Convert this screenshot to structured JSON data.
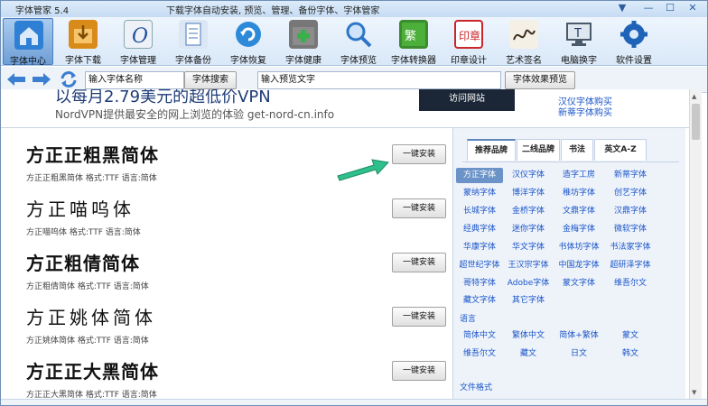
{
  "window": {
    "app_title": "字体管家 5.4",
    "doc_title": "下载字体自动安装, 预览、管理、备份字体、字体管家",
    "buttons": {
      "menu": "▼",
      "minimize": "—",
      "maximize": "☐",
      "close": "✕"
    }
  },
  "toolbar": {
    "items": [
      {
        "label": "字体中心",
        "icon": "home-icon",
        "color": "#2f7fd4"
      },
      {
        "label": "字体下载",
        "icon": "download-box-icon",
        "color": "#d98b1a"
      },
      {
        "label": "字体管理",
        "icon": "font-manage-icon",
        "color": "#1f4f9c"
      },
      {
        "label": "字体备份",
        "icon": "document-icon",
        "color": "#4a78b8"
      },
      {
        "label": "字体恢复",
        "icon": "restore-icon",
        "color": "#2c8ad8"
      },
      {
        "label": "字体健康",
        "icon": "medkit-icon",
        "color": "#3a9a3a"
      },
      {
        "label": "字体预览",
        "icon": "magnifier-icon",
        "color": "#2d76c7"
      },
      {
        "label": "字体转换器",
        "icon": "converter-icon",
        "color": "#3a8c2e"
      },
      {
        "label": "印章设计",
        "icon": "seal-icon",
        "color": "#c8262a"
      },
      {
        "label": "艺术签名",
        "icon": "signature-icon",
        "color": "#8a6a3a"
      },
      {
        "label": "电脑换字",
        "icon": "monitor-icon",
        "color": "#4a5a6a"
      },
      {
        "label": "软件设置",
        "icon": "gear-icon",
        "color": "#1f63b8"
      }
    ]
  },
  "search": {
    "name_input": "输入字体名称",
    "search_button": "字体搜索",
    "preview_input": "输入预览文字",
    "effect_button": "字体效果预览"
  },
  "ad": {
    "headline": "以每月2.79美元的超低价VPN",
    "subline": "NordVPN提供最安全的网上浏览的体验 get-nord-cn.info",
    "visit_button": "访问网站",
    "link1": "汉仪字体购买",
    "link2": "新蒂字体购买"
  },
  "fonts": [
    {
      "sample": "方正正粗黑简体",
      "meta": "方正正粗黑简体  格式:TTF 语言:简体",
      "install": "一键安装",
      "style": "bold"
    },
    {
      "sample": "方正喵呜体",
      "meta": "方正喵呜体  格式:TTF 语言:简体",
      "install": "一键安装",
      "style": "light"
    },
    {
      "sample": "方正粗倩简体",
      "meta": "方正粗倩简体  格式:TTF 语言:简体",
      "install": "一键安装",
      "style": "bold"
    },
    {
      "sample": "方正姚体简体",
      "meta": "方正姚体简体  格式:TTF 语言:简体",
      "install": "一键安装",
      "style": "light"
    },
    {
      "sample": "方正正大黑简体",
      "meta": "方正正大黑简体  格式:TTF 语言:简体",
      "install": "一键安装",
      "style": "bold"
    }
  ],
  "panel": {
    "tabs": [
      "推荐品牌",
      "二线品牌",
      "书法",
      "英文A-Z"
    ],
    "brands": [
      [
        "方正字体",
        "汉仪字体",
        "造字工房",
        "新蒂字体"
      ],
      [
        "蒙纳字体",
        "博洋字体",
        "稚坊字体",
        "创艺字体"
      ],
      [
        "长城字体",
        "金桥字体",
        "文鼎字体",
        "汉鼎字体"
      ],
      [
        "经典字体",
        "迷你字体",
        "金梅字体",
        "微软字体"
      ],
      [
        "华康字体",
        "华文字体",
        "书体坊字体",
        "书法家字体"
      ],
      [
        "超世纪字体",
        "王汉宗字体",
        "中国龙字体",
        "超研泽字体"
      ],
      [
        "哥特字体",
        "Adobe字体",
        "蒙文字体",
        "维吾尔文"
      ],
      [
        "藏文字体",
        "其它字体"
      ]
    ],
    "language_label": "语言",
    "languages": [
      [
        "简体中文",
        "繁体中文",
        "简体+繁体",
        "蒙文"
      ],
      [
        "维吾尔文",
        "藏文",
        "日文",
        "韩文"
      ]
    ],
    "format_label": "文件格式"
  }
}
